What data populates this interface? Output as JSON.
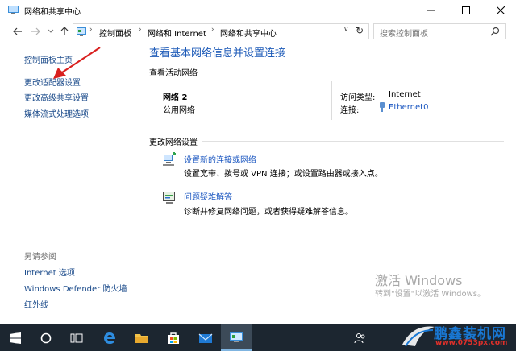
{
  "window": {
    "title": "网络和共享中心"
  },
  "address_bar": {
    "crumbs": [
      "控制面板",
      "网络和 Internet",
      "网络和共享中心"
    ],
    "search_placeholder": "搜索控制面板"
  },
  "sidebar": {
    "links": [
      "控制面板主页",
      "更改适配器设置",
      "更改高级共享设置",
      "媒体流式处理选项"
    ],
    "see_also_heading": "另请参阅",
    "see_also": [
      "Internet 选项",
      "Windows Defender 防火墙",
      "红外线"
    ]
  },
  "main": {
    "title": "查看基本网络信息并设置连接",
    "active_heading": "查看活动网络",
    "network": {
      "name": "网络 2",
      "category": "公用网络",
      "access_label": "访问类型:",
      "access_value": "Internet",
      "conn_label": "连接:",
      "conn_value": "Ethernet0"
    },
    "change_heading": "更改网络设置",
    "tasks": [
      {
        "link": "设置新的连接或网络",
        "desc": "设置宽带、拨号或 VPN 连接；或设置路由器或接入点。",
        "icon": "new-connection-icon"
      },
      {
        "link": "问题疑难解答",
        "desc": "诊断并修复网络问题，或者获得疑难解答信息。",
        "icon": "troubleshoot-icon"
      }
    ]
  },
  "activation": {
    "title": "激活 Windows",
    "subtitle": "转到\"设置\"以激活 Windows。"
  },
  "watermark": {
    "name": "鹏鑫装机网",
    "url": "www.0753px.com"
  },
  "taskbar": {
    "icons": [
      "windows-start-icon",
      "cortana-circle-icon",
      "task-view-icon",
      "edge-icon",
      "file-explorer-icon",
      "store-icon",
      "mail-icon",
      "network-center-app-icon"
    ]
  },
  "colors": {
    "link": "#1a56c0",
    "title_blue": "#1e5bb8",
    "taskbar": "#1c2630",
    "annotation_arrow": "#d9201f"
  }
}
